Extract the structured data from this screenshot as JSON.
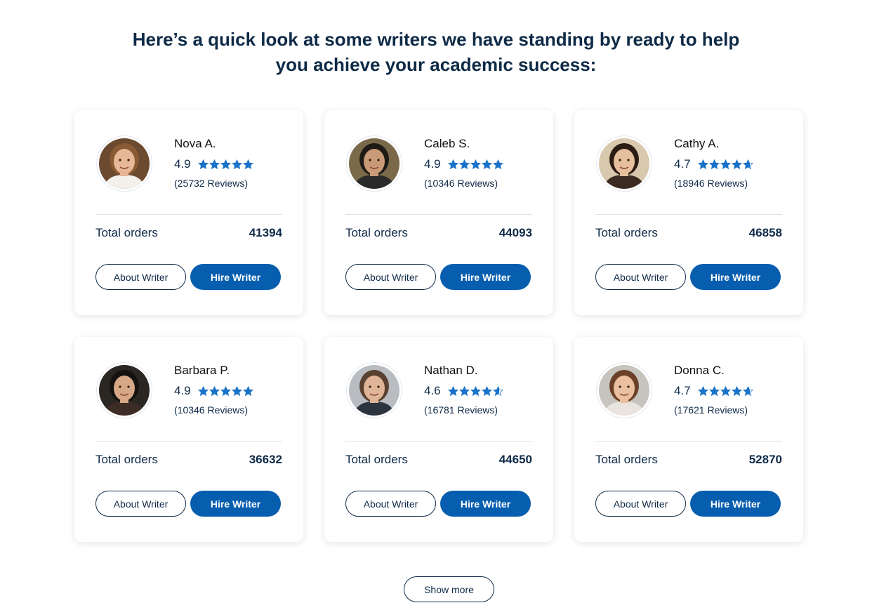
{
  "heading": {
    "line1": "Here’s a quick look at some writers we have standing by ready to help",
    "line2": "you achieve your academic success:"
  },
  "colors": {
    "accent": "#075eae",
    "text_dark": "#0e2a47",
    "star": "#1a73c8"
  },
  "writers": [
    {
      "name": "Nova A.",
      "rating": "4.9",
      "rating_value": 4.9,
      "reviews": "(25732 Reviews)",
      "orders_label": "Total orders",
      "orders": "41394",
      "about_label": "About Writer",
      "hire_label": "Hire Writer",
      "avatar_palette": {
        "bg": "#6b4a2f",
        "hair": "#8a5a35",
        "skin": "#e7b796",
        "shirt": "#f3efe9"
      }
    },
    {
      "name": "Caleb S.",
      "rating": "4.9",
      "rating_value": 4.9,
      "reviews": "(10346 Reviews)",
      "orders_label": "Total orders",
      "orders": "44093",
      "about_label": "About Writer",
      "hire_label": "Hire Writer",
      "avatar_palette": {
        "bg": "#7a6a4a",
        "hair": "#1e1a16",
        "skin": "#c99a78",
        "shirt": "#2a2a2a"
      }
    },
    {
      "name": "Cathy A.",
      "rating": "4.7",
      "rating_value": 4.7,
      "reviews": "(18946 Reviews)",
      "orders_label": "Total orders",
      "orders": "46858",
      "about_label": "About Writer",
      "hire_label": "Hire Writer",
      "avatar_palette": {
        "bg": "#d8c8ad",
        "hair": "#2b1d14",
        "skin": "#e6bf9c",
        "shirt": "#3a2a22"
      }
    },
    {
      "name": "Barbara P.",
      "rating": "4.9",
      "rating_value": 4.9,
      "reviews": "(10346 Reviews)",
      "orders_label": "Total orders",
      "orders": "36632",
      "about_label": "About Writer",
      "hire_label": "Hire Writer",
      "avatar_palette": {
        "bg": "#2a2622",
        "hair": "#141210",
        "skin": "#d7a886",
        "shirt": "#3d2c26"
      }
    },
    {
      "name": "Nathan D.",
      "rating": "4.6",
      "rating_value": 4.6,
      "reviews": "(16781 Reviews)",
      "orders_label": "Total orders",
      "orders": "44650",
      "about_label": "About Writer",
      "hire_label": "Hire Writer",
      "avatar_palette": {
        "bg": "#b9bcc0",
        "hair": "#5a4030",
        "skin": "#e0b496",
        "shirt": "#2c3440"
      }
    },
    {
      "name": "Donna C.",
      "rating": "4.7",
      "rating_value": 4.7,
      "reviews": "(17621 Reviews)",
      "orders_label": "Total orders",
      "orders": "52870",
      "about_label": "About Writer",
      "hire_label": "Hire Writer",
      "avatar_palette": {
        "bg": "#c7c3bd",
        "hair": "#6a4026",
        "skin": "#eac0a0",
        "shirt": "#e9e4de"
      }
    }
  ],
  "show_more_label": "Show more"
}
